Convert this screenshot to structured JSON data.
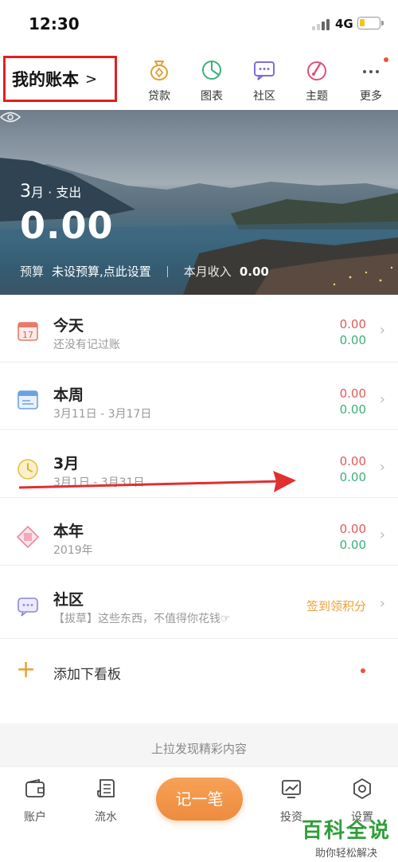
{
  "status": {
    "time": "12:30",
    "network": "4G"
  },
  "header": {
    "book_title": "我的账本",
    "book_chevron": ">",
    "nav": [
      {
        "label": "贷款",
        "icon": "loan-icon"
      },
      {
        "label": "图表",
        "icon": "chart-icon"
      },
      {
        "label": "社区",
        "icon": "community-icon"
      },
      {
        "label": "主题",
        "icon": "theme-icon"
      },
      {
        "label": "更多",
        "icon": "more-icon"
      }
    ]
  },
  "banner": {
    "month": "3",
    "month_suffix": "月 · 支出",
    "amount": "0.00",
    "budget_label": "预算",
    "budget_value": "未设预算,点此设置",
    "income_label": "本月收入",
    "income_value": "0.00"
  },
  "rows": [
    {
      "title": "今天",
      "subtitle": "还没有记过账",
      "expense": "0.00",
      "income": "0.00",
      "icon": "calendar-day-icon"
    },
    {
      "title": "本周",
      "subtitle": "3月11日 - 3月17日",
      "expense": "0.00",
      "income": "0.00",
      "icon": "calendar-week-icon"
    },
    {
      "title": "3月",
      "subtitle": "3月1日 - 3月31日",
      "expense": "0.00",
      "income": "0.00",
      "icon": "moon-month-icon"
    },
    {
      "title": "本年",
      "subtitle": "2019年",
      "expense": "0.00",
      "income": "0.00",
      "icon": "year-diamond-icon"
    },
    {
      "title": "社区",
      "subtitle": "【拔草】这些东西，不值得你花钱☞",
      "action": "签到领积分",
      "icon": "chat-bubble-icon"
    }
  ],
  "add_board": {
    "plus": "+",
    "label": "添加下看板"
  },
  "pull_hint": "上拉发现精彩内容",
  "tabbar": {
    "tabs": [
      {
        "label": "账户",
        "icon": "wallet-icon"
      },
      {
        "label": "流水",
        "icon": "ledger-icon"
      },
      {
        "label": "投资",
        "icon": "invest-icon"
      },
      {
        "label": "设置",
        "icon": "settings-icon"
      }
    ],
    "fab_label": "记一笔"
  },
  "watermark": {
    "line1": "百科全说",
    "line2": "助你轻松解决"
  },
  "colors": {
    "accent": "#ee8b3e",
    "expense": "#e25a5a",
    "income": "#3bb07a",
    "highlight": "#e02020"
  }
}
